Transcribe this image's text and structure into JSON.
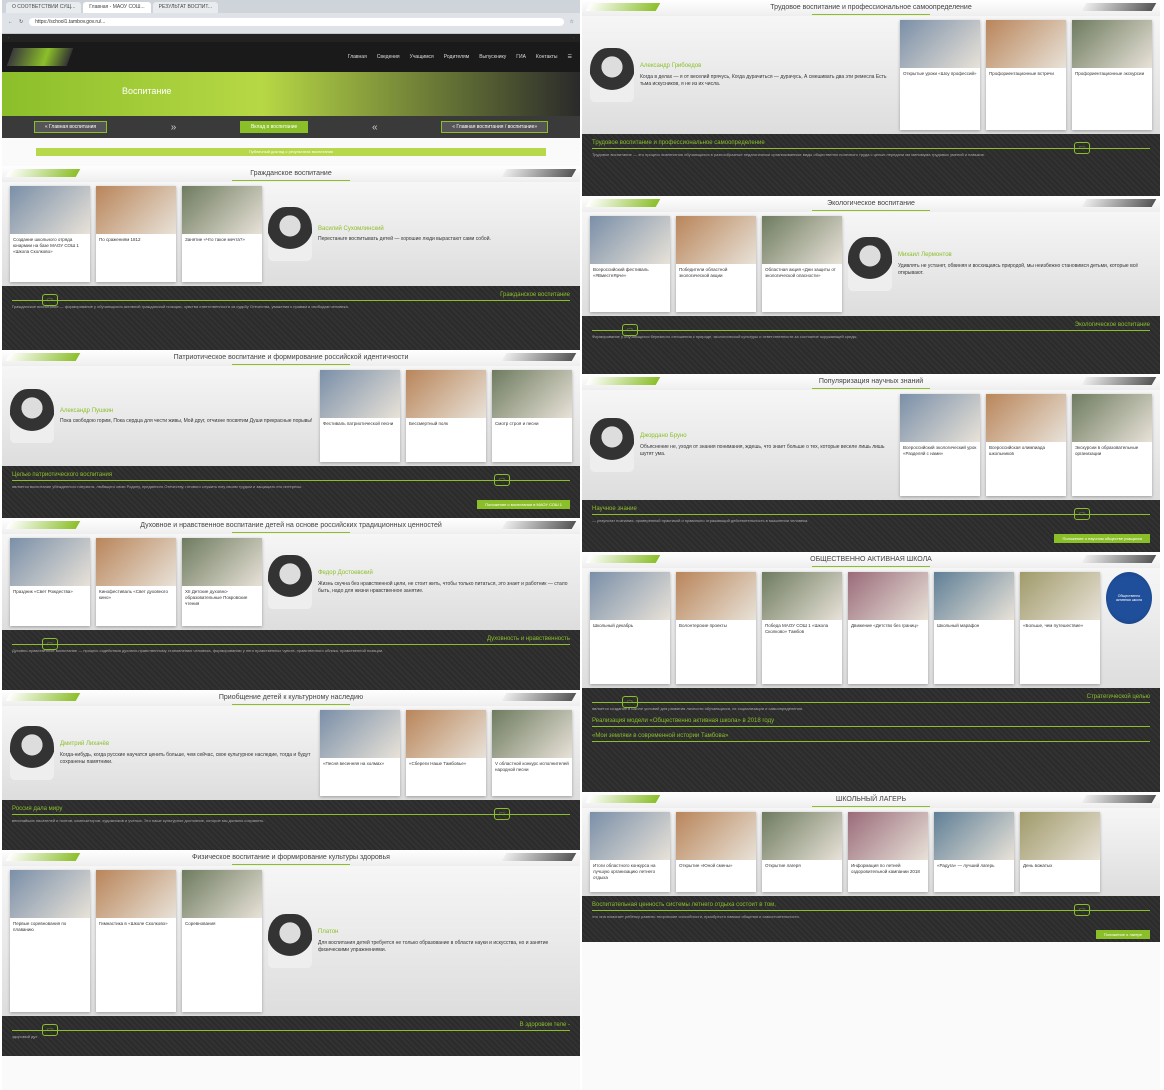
{
  "browser": {
    "tabs": [
      "О СООТВЕТСТВИИ СУЩ...",
      "Главная - МАОУ СОШ...",
      "РЕЗУЛЬТАТ ВОСПИТ..."
    ],
    "url": "https://school1.tambov.gov.ru/..."
  },
  "site": {
    "nav": [
      "Главная",
      "Сведения",
      "Учащимся",
      "Родителям",
      "Выпускнику",
      "ГИА",
      "Контакты"
    ],
    "hero_title": "Воспитание",
    "hero_left": "« Главная воспитания",
    "hero_center": "Вклад в воспитание",
    "hero_right": "« Главная воспитания / воспитание»",
    "banner": "Публичный доклад о результатах воспитания"
  },
  "left_sections": [
    {
      "title": "Гражданское воспитание",
      "cards": [
        "Создание школьного отряда юнармии на базе МАОУ СОШ 1 «Школа Сколково»",
        "По сражениям 1812",
        "Занятие «Что такое мечта?»"
      ],
      "quote_author": "Василий Сухомлинский",
      "quote": "Перестаньте воспитывать детей — хорошие люди вырастают сами собой.",
      "dark_title": "Гражданское воспитание",
      "dark_text": "Гражданское воспитание — формирование у обучающихся активной гражданской позиции, чувства ответственности за судьбу Отечества, уважения к правам и свободам человека."
    },
    {
      "title": "Патриотическое воспитание и формирование российской идентичности",
      "cards": [
        "Фестиваль патриотической песни",
        "Бессмертный полк",
        "Смотр строя и песни"
      ],
      "quote_author": "Александр Пушкин",
      "quote": "Пока свободою горим, Пока сердца для чести живы, Мой друг, отчизне посвятим Души прекрасные порывы!",
      "dark_title": "Целью патриотического воспитания",
      "dark_text": "является воспитание убежденного патриота, любящего свою Родину, преданного Отечеству, готового служить ему своим трудом и защищать его интересы.",
      "btn": "Положение о воспитании в МАОУ СОШ 1"
    },
    {
      "title": "Духовное и нравственное воспитание детей на основе российских традиционных ценностей",
      "cards": [
        "Праздник «Свет Рождества»",
        "Кинофестиваль «Свет духовного кино»",
        "XII Детские духовно-образовательные Покровские чтения"
      ],
      "quote_author": "Федор Достоевский",
      "quote": "Жизнь скучна без нравственной цели, не стоит жить, чтобы только питаться, это знает и работник — стало быть, надо для жизни нравственное занятие.",
      "dark_title": "Духовность и нравственность",
      "dark_text": "Духовно-нравственное воспитание — процесс содействия духовно-нравственному становлению человека, формированию у него нравственных чувств, нравственного облика, нравственной позиции."
    },
    {
      "title": "Приобщение детей к культурному наследию",
      "cards": [
        "«Песня весенняя на холмах»",
        "«Сбереги Наше Тамбовье»",
        "V областной конкурс исполнителей народной песни"
      ],
      "quote_author": "Дмитрий Лихачёв",
      "quote": "Когда-нибудь, когда русские научатся ценить больше, чем сейчас, свое культурное наследие, тогда и будут сохранены памятники.",
      "dark_title": "Россия дала миру",
      "dark_text": "величайших писателей и поэтов, композиторов, художников и ученых. Это наше культурное достояние, которое мы должны сохранить."
    },
    {
      "title": "Физическое воспитание и формирование культуры здоровья",
      "cards": [
        "Первые соревнования по плаванию",
        "Гимнастика в «Школе Сколково»",
        "Соревнования"
      ],
      "quote_author": "Платон",
      "quote": "Для воспитания детей требуется не только образование в области науки и искусства, но и занятие физическими упражнениями.",
      "dark_title": "В здоровом теле -",
      "dark_text": "здоровый дух"
    }
  ],
  "right_sections": [
    {
      "title": "Трудовое воспитание и профессиональное самоопределение",
      "cards": [
        "Открытые уроки «Шоу профессий»",
        "Профориентационные встречи",
        "Профориентационные экскурсии"
      ],
      "quote_author": "Александр Грибоедов",
      "quote": "Когда в делах — я от веселий прячусь, Когда дурачиться — дурачусь, А смешивать два эти ремесла Есть тьма искусников, я не из их числа.",
      "dark_title": "Трудовое воспитание и профессиональное самоопределение",
      "dark_text": "Трудовое воспитание — это процесс вовлечения обучающихся в разнообразные педагогически организованные виды общественно полезного труда с целью передачи им минимума трудовых умений и навыков."
    },
    {
      "title": "Экологическое воспитание",
      "cards": [
        "Всероссийский фестиваль «#ВместеЯрче»",
        "Победители областной экологической акции",
        "Областная акция «Дни защиты от экологической опасности»"
      ],
      "quote_author": "Михаил Лермонтов",
      "quote": "Удивлять не устанет, обвиняя и восхищаясь природой, мы неизбежно становимся детьми, которые всё открывают.",
      "dark_title": "Экологическое воспитание",
      "dark_text": "Формирование у обучающихся бережного отношения к природе, экологической культуры и ответственности за состояние окружающей среды."
    },
    {
      "title": "Популяризация научных знаний",
      "cards": [
        "Всероссийский экологический урок «Разделяй с нами»",
        "Всероссийская олимпиада школьников",
        "Экскурсии в образовательные организации"
      ],
      "quote_author": "Джордано Бруно",
      "quote": "Объяснение не, уходя от знания понимания, ждешь, что знает больше о тех, которые веселе лишь лишь шутят ума.",
      "dark_title": "Научное знание",
      "dark_text": "— результат познания, проверенный практикой и правильно отражающий действительность в мышлении человека.",
      "btn": "Положение о научном обществе учащихся"
    },
    {
      "title": "ОБЩЕСТВЕННО АКТИВНАЯ ШКОЛА",
      "cards": [
        "Школьный декабрь",
        "Волонтерские проекты",
        "Победа МАОУ СОШ 1 «Школа Сколково» Тамбов",
        "Движение «Детство без границ»",
        "Школьный марафон",
        "«Больше, чем путешествие»"
      ],
      "badge": "Общественно активная школа",
      "dark_title": "Стратегической целью",
      "dark_text": "является создание в школе условий для развития личности обучающихся, их социализации и самоопределения.",
      "sub1": "Реализация модели «Общественно активная школа» в 2018 году",
      "sub2": "«Мои земляки в современной истории Тамбова»"
    },
    {
      "title": "ШКОЛЬНЫЙ ЛАГЕРЬ",
      "cards": [
        "Итоги областного конкурса на лучшую организацию летнего отдыха",
        "Открытие «Юной смены»",
        "Открытие лагеря",
        "Информация по летней оздоровительной кампании 2018",
        "«Радуга» — лучший лагерь",
        "День вожатых"
      ],
      "dark_title": "Воспитательная ценность системы летнего отдыха состоит в том,",
      "dark_text": "что она помогает ребенку развить творческие способности, приобрести навыки общения и самостоятельности.",
      "btn": "Положение о лагере"
    }
  ],
  "colors": {
    "accent": "#8bbf2a",
    "dark": "#2b2b2b"
  }
}
